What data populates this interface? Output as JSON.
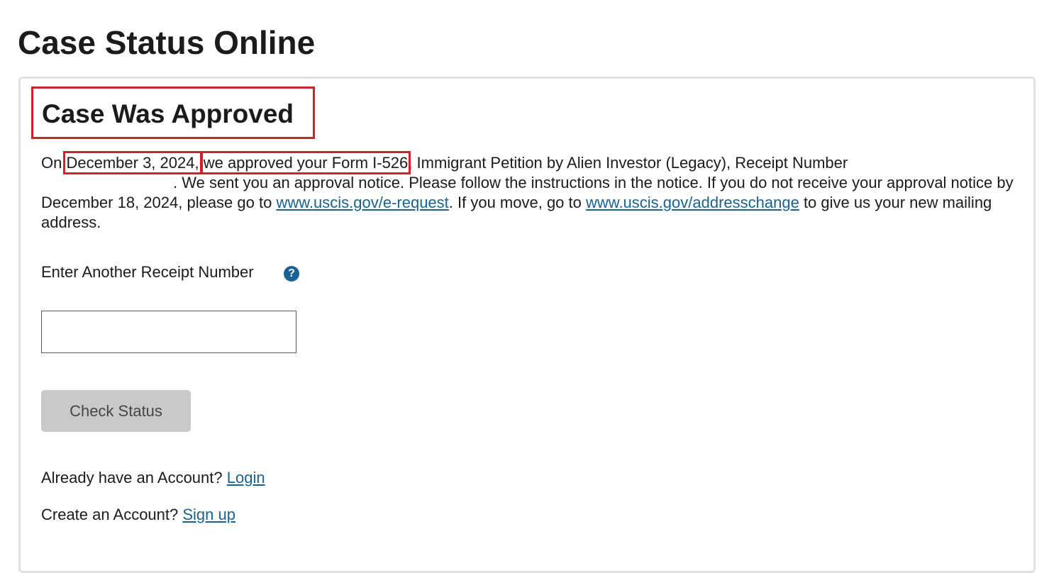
{
  "page": {
    "title": "Case Status Online"
  },
  "status": {
    "heading": "Case Was Approved",
    "text_on": "On ",
    "date": "December 3, 2024,",
    "approval_phrase": "we approved your Form I-526",
    "text_after_form": ", Immigrant Petition by Alien Investor (Legacy), Receipt Number",
    "text_notice": ". We sent you an approval notice. Please follow the instructions in the notice. If you do not receive your approval notice by December 18, 2024, please go to ",
    "link_erequest": "www.uscis.gov/e-request",
    "text_move": ". If you move, go to ",
    "link_addresschange": "www.uscis.gov/addresschange",
    "text_end": " to give us your new mailing address."
  },
  "receipt": {
    "label": "Enter Another Receipt Number",
    "help_icon": "question-circle-icon",
    "help_glyph": "?",
    "input_value": "",
    "input_placeholder": ""
  },
  "actions": {
    "check_status_label": "Check Status"
  },
  "account": {
    "login_prompt": "Already have an Account? ",
    "login_link": "Login",
    "signup_prompt": "Create an Account? ",
    "signup_link": "Sign up"
  },
  "colors": {
    "highlight_border": "#d0222b",
    "link": "#1a6293",
    "button_disabled_bg": "#c9c9c9",
    "card_border": "#dfe1e2"
  }
}
